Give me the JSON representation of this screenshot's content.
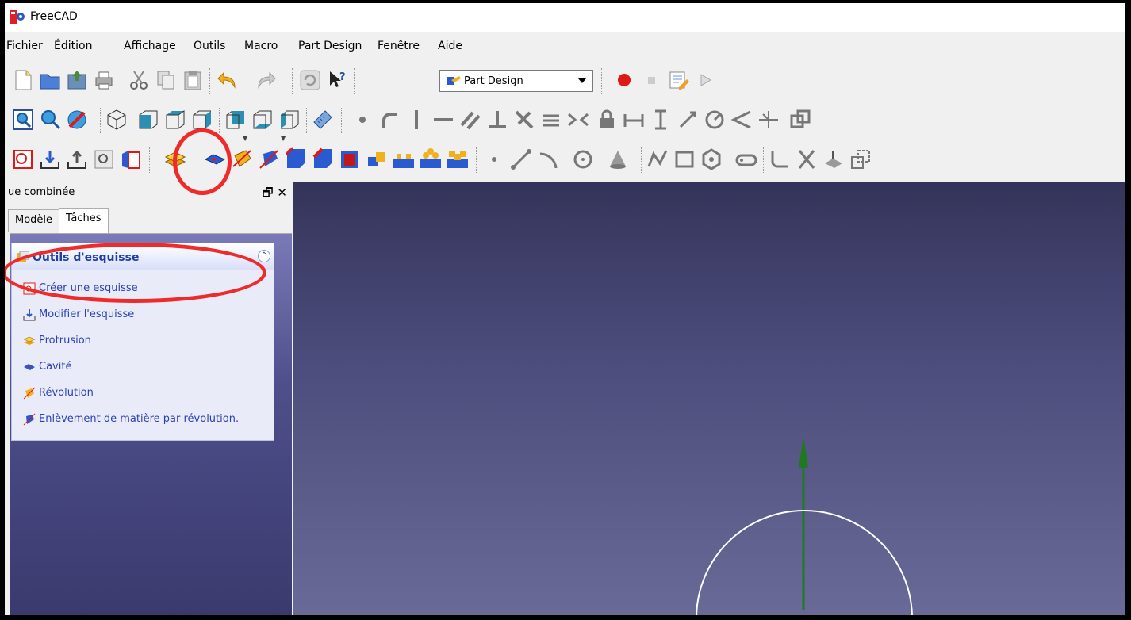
{
  "window": {
    "title": "FreeCAD"
  },
  "menubar": {
    "items": [
      "Fichier",
      "Édition",
      "Affichage",
      "Outils",
      "Macro",
      "Part Design",
      "Fenêtre",
      "Aide"
    ]
  },
  "toolbar": {
    "workbench_selected": "Part Design"
  },
  "combo_view": {
    "title": "ue combinée",
    "float_glyph": "🗗",
    "close_glyph": "✕"
  },
  "tabs": [
    {
      "label": "Modèle"
    },
    {
      "label": "Tâches",
      "active": true
    }
  ],
  "task_panel": {
    "title": "Outils d'esquisse",
    "items": [
      {
        "label": "Créer une esquisse",
        "icon": "sketch-new-icon"
      },
      {
        "label": "Modifier l'esquisse",
        "icon": "sketch-edit-icon"
      },
      {
        "label": "Protrusion",
        "icon": "pad-icon"
      },
      {
        "label": "Cavité",
        "icon": "pocket-icon"
      },
      {
        "label": "Révolution",
        "icon": "revolution-icon"
      },
      {
        "label": "Enlèvement de matière par révolution.",
        "icon": "groove-icon"
      }
    ]
  },
  "colors": {
    "annotation_red": "#ee2a2a",
    "axis_green": "#1f7a1f",
    "link_blue": "#2a42b8",
    "viewport_top": "#34345a",
    "viewport_bottom": "#6a6a98"
  }
}
